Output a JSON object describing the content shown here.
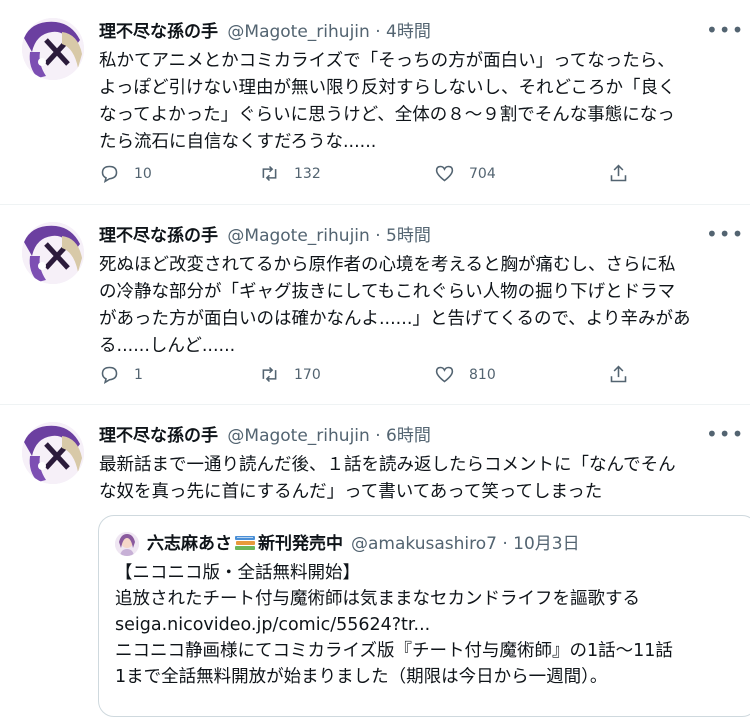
{
  "tweets": [
    {
      "name": "理不尽な孫の手",
      "handle": "@Magote_rihujin · 4時間",
      "text": "私かてアニメとかコミカライズで「そっちの方が面白い」ってなったら、\nよっぽど引けない理由が無い限り反対すらしないし、それどころか「良く\nなってよかった」ぐらいに思うけど、全体の８～９割でそんな事態になっ\nたら流石に自信なくすだろうな......",
      "replies": "10",
      "retweets": "132",
      "likes": "704"
    },
    {
      "name": "理不尽な孫の手",
      "handle": "@Magote_rihujin · 5時間",
      "text": "死ぬほど改変されてるから原作者の心境を考えると胸が痛むし、さらに私\nの冷静な部分が「ギャグ抜きにしてもこれぐらい人物の掘り下げとドラマ\nがあった方が面白いのは確かなんよ......」と告げてくるので、より辛みがあ\nる......しんど......",
      "replies": "1",
      "retweets": "170",
      "likes": "810"
    },
    {
      "name": "理不尽な孫の手",
      "handle": "@Magote_rihujin · 6時間",
      "text": "最新話まで一通り読んだ後、１話を読み返したらコメントに「なんでそん\nな奴を真っ先に首にするんだ」って書いてあって笑ってしまった"
    }
  ],
  "quote": {
    "name": "六志麻あさ",
    "badge": "新刊発売中",
    "handle": "@amakusashiro7 · 10月3日",
    "text": "【ニコニコ版・全話無料開始】\n追放されたチート付与魔術師は気ままなセカンドライフを謳歌する\nseiga.nicovideo.jp/comic/55624?tr...\nニコニコ静画様にてコミカライズ版『チート付与魔術師』の1話～11話\n1まで全話無料開放が始まりました（期限は今日から一週間）。"
  },
  "icons": [
    "more-icon",
    "reply-icon",
    "retweet-icon",
    "like-icon",
    "share-icon",
    "books-emoji-icon"
  ],
  "colors": {
    "text": "#0f1419",
    "secondary": "#536471",
    "border": "#cfd9de",
    "avatar_purple": "#6b3fa0"
  }
}
